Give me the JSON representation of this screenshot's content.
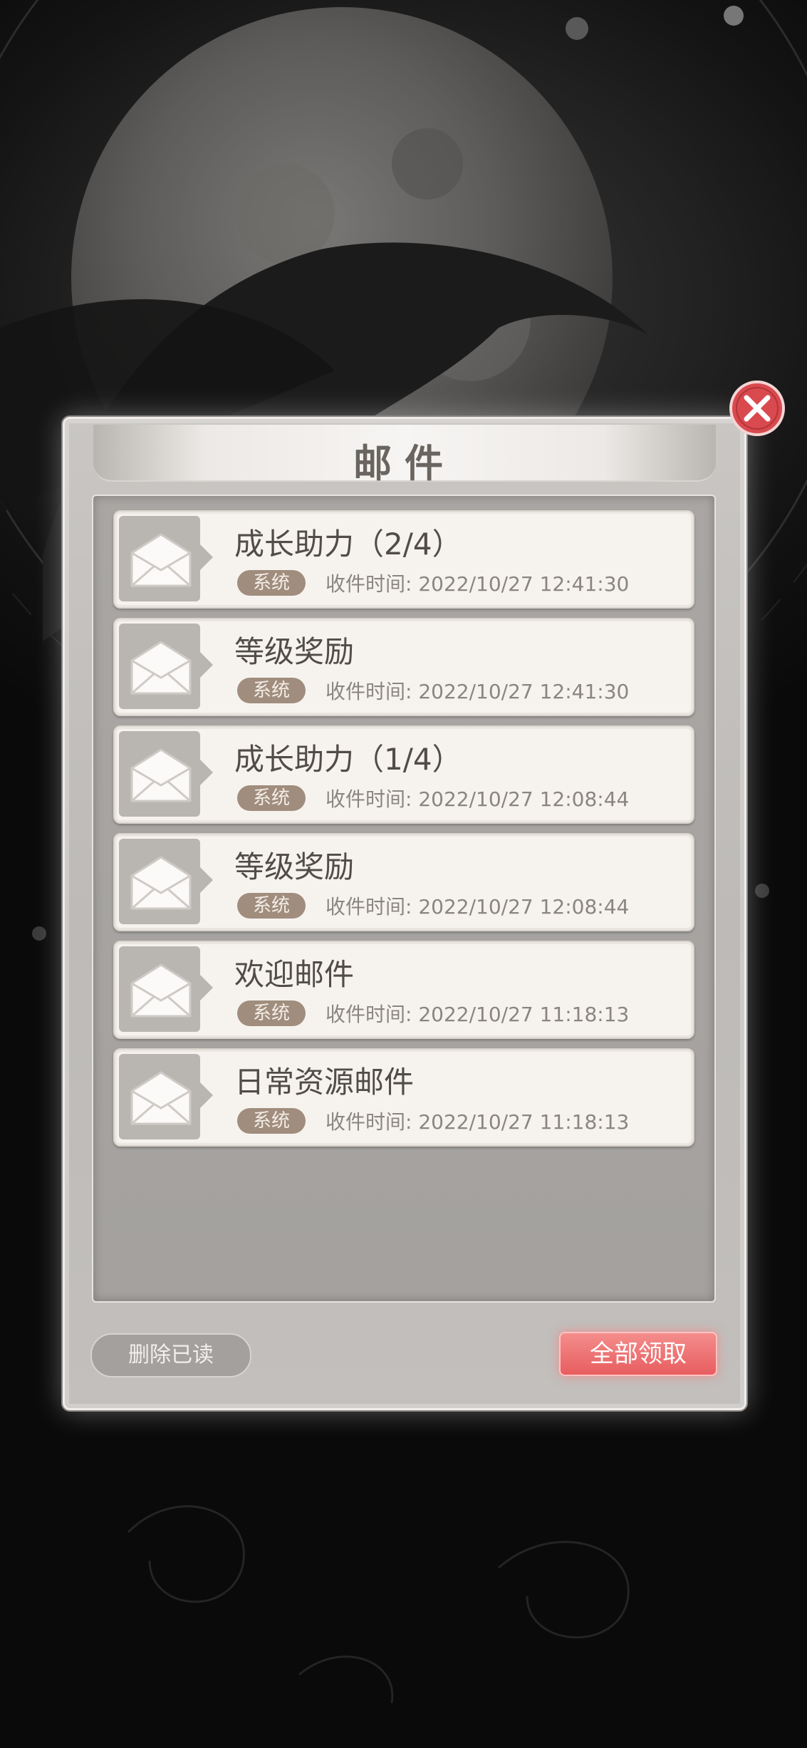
{
  "panel": {
    "title": "邮件"
  },
  "mails": [
    {
      "title": "成长助力（2/4）",
      "tag": "系统",
      "time": "收件时间: 2022/10/27 12:41:30"
    },
    {
      "title": "等级奖励",
      "tag": "系统",
      "time": "收件时间: 2022/10/27 12:41:30"
    },
    {
      "title": "成长助力（1/4）",
      "tag": "系统",
      "time": "收件时间: 2022/10/27 12:08:44"
    },
    {
      "title": "等级奖励",
      "tag": "系统",
      "time": "收件时间: 2022/10/27 12:08:44"
    },
    {
      "title": "欢迎邮件",
      "tag": "系统",
      "time": "收件时间: 2022/10/27 11:18:13"
    },
    {
      "title": "日常资源邮件",
      "tag": "系统",
      "time": "收件时间: 2022/10/27 11:18:13"
    }
  ],
  "buttons": {
    "delete_read": "删除已读",
    "claim_all": "全部领取"
  },
  "icons": {
    "close": "close-icon",
    "envelope": "envelope-icon"
  },
  "colors": {
    "claim_button": "#e85d5f",
    "tag_background": "#a08d7d"
  }
}
